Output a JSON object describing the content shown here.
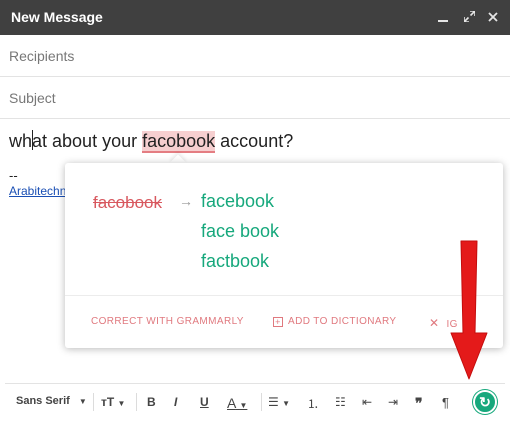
{
  "window": {
    "title": "New Message",
    "minimize_icon": "minimize-icon",
    "popout_icon": "expand-icon",
    "close_icon": "close-icon"
  },
  "fields": {
    "recipients_placeholder": "Recipients",
    "subject_placeholder": "Subject"
  },
  "body": {
    "text_before_cursor": "wh",
    "text_after_cursor": "at about your ",
    "misspelled_word": "facobook",
    "text_end": " account?",
    "signature_dash": "--",
    "signature_link": "Arabitechnomedia"
  },
  "grammarly_popup": {
    "original": "facobook",
    "arrow": "→",
    "suggestions": [
      "facebook",
      "face book",
      "factbook"
    ],
    "actions": {
      "correct": "CORRECT WITH GRAMMARLY",
      "add_to_dictionary": "ADD TO DICTIONARY",
      "ignore": "IG"
    },
    "accent_color": "#16a87c",
    "error_color": "#d8585f"
  },
  "toolbar": {
    "font": "Sans Serif",
    "size_icon": "text-size-icon",
    "bold": "B",
    "italic": "I",
    "underline": "U",
    "text_color": "A",
    "quote": "❞",
    "clear_format": "¶"
  }
}
